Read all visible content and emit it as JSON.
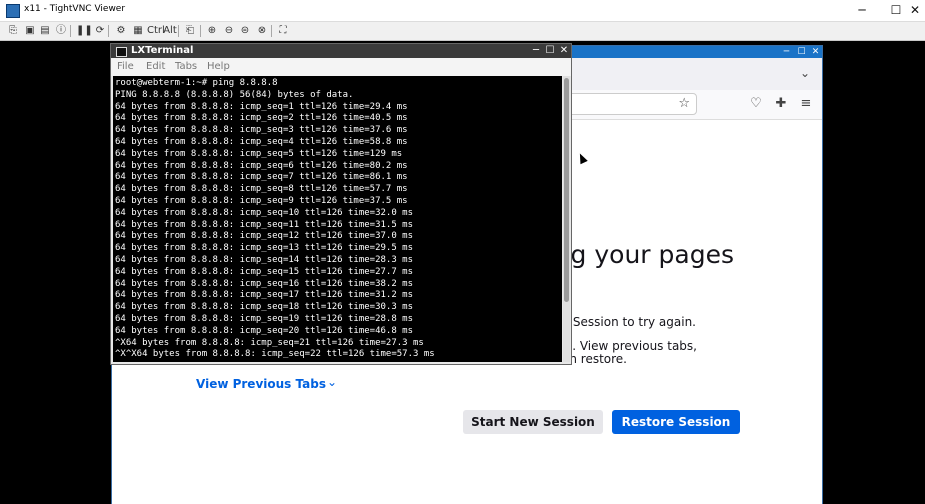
{
  "vnc": {
    "title": "x11 - TightVNC Viewer",
    "controls": {
      "minimize": "─",
      "maximize": "☐",
      "close": "✕"
    },
    "toolbar": [
      {
        "name": "new-connection-icon",
        "glyph": "⎘"
      },
      {
        "name": "save-icon",
        "glyph": "▣"
      },
      {
        "name": "options-icon",
        "glyph": "▤"
      },
      {
        "name": "info-icon",
        "glyph": "ⓘ"
      },
      {
        "name": "pause-icon",
        "glyph": "❚❚"
      },
      {
        "name": "refresh-icon",
        "glyph": "⟳"
      },
      {
        "name": "ctrl-alt-del-icon",
        "glyph": "⚙"
      },
      {
        "name": "ctrl-esc-icon",
        "glyph": "▦"
      },
      {
        "name": "ctrl-toggle",
        "glyph": "Ctrl"
      },
      {
        "name": "alt-toggle",
        "glyph": "Alt"
      },
      {
        "name": "clipboard-icon",
        "glyph": "⎗"
      },
      {
        "name": "zoom-in-icon",
        "glyph": "⊕"
      },
      {
        "name": "zoom-out-icon",
        "glyph": "⊖"
      },
      {
        "name": "zoom-100-icon",
        "glyph": "⊜"
      },
      {
        "name": "zoom-fit-icon",
        "glyph": "⊗"
      },
      {
        "name": "fullscreen-icon",
        "glyph": "⛶"
      }
    ]
  },
  "terminal": {
    "title": "LXTerminal",
    "menu": [
      "File",
      "Edit",
      "Tabs",
      "Help"
    ],
    "output": "root@webterm-1:~# ping 8.8.8.8\nPING 8.8.8.8 (8.8.8.8) 56(84) bytes of data.\n64 bytes from 8.8.8.8: icmp_seq=1 ttl=126 time=29.4 ms\n64 bytes from 8.8.8.8: icmp_seq=2 ttl=126 time=40.5 ms\n64 bytes from 8.8.8.8: icmp_seq=3 ttl=126 time=37.6 ms\n64 bytes from 8.8.8.8: icmp_seq=4 ttl=126 time=58.8 ms\n64 bytes from 8.8.8.8: icmp_seq=5 ttl=126 time=129 ms\n64 bytes from 8.8.8.8: icmp_seq=6 ttl=126 time=80.2 ms\n64 bytes from 8.8.8.8: icmp_seq=7 ttl=126 time=86.1 ms\n64 bytes from 8.8.8.8: icmp_seq=8 ttl=126 time=57.7 ms\n64 bytes from 8.8.8.8: icmp_seq=9 ttl=126 time=37.5 ms\n64 bytes from 8.8.8.8: icmp_seq=10 ttl=126 time=32.0 ms\n64 bytes from 8.8.8.8: icmp_seq=11 ttl=126 time=31.5 ms\n64 bytes from 8.8.8.8: icmp_seq=12 ttl=126 time=37.0 ms\n64 bytes from 8.8.8.8: icmp_seq=13 ttl=126 time=29.5 ms\n64 bytes from 8.8.8.8: icmp_seq=14 ttl=126 time=28.3 ms\n64 bytes from 8.8.8.8: icmp_seq=15 ttl=126 time=27.7 ms\n64 bytes from 8.8.8.8: icmp_seq=16 ttl=126 time=38.2 ms\n64 bytes from 8.8.8.8: icmp_seq=17 ttl=126 time=31.2 ms\n64 bytes from 8.8.8.8: icmp_seq=18 ttl=126 time=30.3 ms\n64 bytes from 8.8.8.8: icmp_seq=19 ttl=126 time=28.8 ms\n64 bytes from 8.8.8.8: icmp_seq=20 ttl=126 time=46.8 ms\n^X64 bytes from 8.8.8.8: icmp_seq=21 ttl=126 time=27.3 ms\n^X^X64 bytes from 8.8.8.8: icmp_seq=22 ttl=126 time=57.3 ms"
  },
  "firefox": {
    "heading_visible": "ng your pages",
    "p1_visible": "ore Session to try again.",
    "p2_visible": "sue. View previous tabs,",
    "p3_visible": "en restore.",
    "view_previous_tabs": "View Previous Tabs",
    "start_new_session": "Start New Session",
    "restore_session": "Restore Session"
  },
  "colors": {
    "accent": "#0061e0",
    "ff_titlebar": "#1a73c7",
    "terminal_bg": "#000000"
  }
}
